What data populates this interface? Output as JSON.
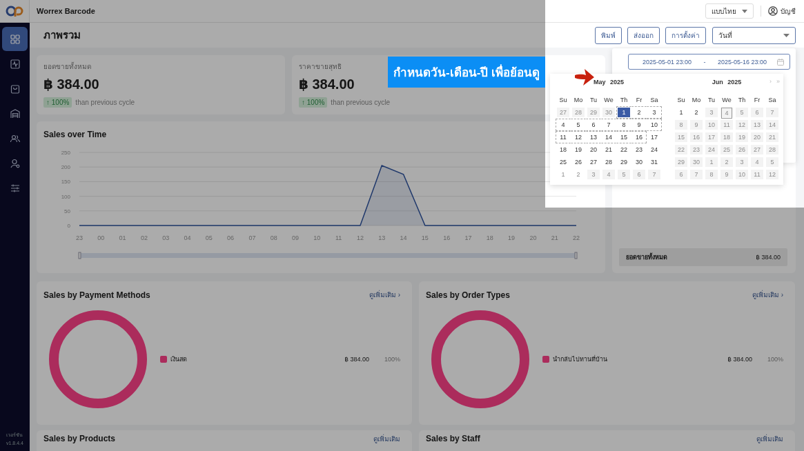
{
  "app": {
    "title": "Worrex Barcode",
    "version_label": "เวอร์ชัน",
    "version": "v1.8.4.4"
  },
  "topbar": {
    "language": "แบบไทย",
    "account": "บัญชี"
  },
  "sidebar": {
    "items": [
      {
        "kind": "grid",
        "selected": true
      },
      {
        "kind": "pulse",
        "selected": false
      },
      {
        "kind": "bag",
        "selected": false
      },
      {
        "kind": "garage",
        "selected": false
      },
      {
        "kind": "users",
        "selected": false
      },
      {
        "kind": "user",
        "selected": false
      },
      {
        "kind": "sliders",
        "selected": false
      }
    ]
  },
  "page": {
    "title": "ภาพรวม",
    "buttons": [
      "พิมพ์",
      "ส่งออก",
      "การตั้งค่า"
    ],
    "period_select": "วันที่"
  },
  "date_range": {
    "start": "2025-05-01 23:00",
    "separator": "-",
    "end": "2025-05-16 23:00"
  },
  "stats": [
    {
      "label": "ยอดขายทั้งหมด",
      "value": "฿ 384.00",
      "change": "↑ 100%",
      "note": "than previous cycle"
    },
    {
      "label": "ราคาขายสุทธิ",
      "value": "฿ 384.00",
      "change": "↑ 100%",
      "note": "than previous cycle"
    }
  ],
  "sales_over_time": {
    "title": "Sales over Time",
    "chart_data": {
      "type": "line",
      "grid": true,
      "categories": [
        "23",
        "00",
        "01",
        "02",
        "03",
        "04",
        "05",
        "06",
        "07",
        "08",
        "09",
        "10",
        "11",
        "12",
        "13",
        "14",
        "15",
        "16",
        "17",
        "18",
        "19",
        "20",
        "21",
        "22"
      ],
      "series": [
        {
          "color": "#2f54a0",
          "values": [
            0,
            0,
            0,
            0,
            0,
            0,
            0,
            0,
            0,
            0,
            0,
            0,
            0,
            0,
            205,
            175,
            0,
            0,
            0,
            0,
            0,
            0,
            0,
            0
          ]
        }
      ],
      "ylim": [
        0,
        250
      ],
      "yticks": [
        0,
        50,
        100,
        150,
        200,
        250
      ]
    }
  },
  "summary": {
    "label": "ยอดขายทั้งหมด",
    "value": "฿ 384.00"
  },
  "breakdowns": [
    {
      "title": "Sales by Payment Methods",
      "link": "ดูเพิ่มเติม ›",
      "items": [
        {
          "label": "เงินสด",
          "amount": "฿ 384.00",
          "percent": "100%",
          "color": "#b02c5c"
        }
      ]
    },
    {
      "title": "Sales by Order Types",
      "link": "ดูเพิ่มเติม ›",
      "items": [
        {
          "label": "นำกลับไปทานที่บ้าน",
          "amount": "฿ 384.00",
          "percent": "100%",
          "color": "#b02c5c"
        }
      ]
    }
  ],
  "more_sections": [
    {
      "title": "Sales by Products",
      "link": "ดูเพิ่มเติม"
    },
    {
      "title": "Sales by Staff",
      "link": "ดูเพิ่มเติม"
    }
  ],
  "calendar": {
    "months": [
      {
        "title": "May 2025",
        "weekdays": [
          "Su",
          "Mo",
          "Tu",
          "We",
          "Th",
          "Fr",
          "Sa"
        ],
        "weeks": [
          [
            {
              "label": "27",
              "muted": true,
              "disabled": true,
              "selected": false,
              "in_range": false,
              "today": false
            },
            {
              "label": "28",
              "muted": true,
              "disabled": true,
              "selected": false,
              "in_range": false,
              "today": false
            },
            {
              "label": "29",
              "muted": true,
              "disabled": true,
              "selected": false,
              "in_range": false,
              "today": false
            },
            {
              "label": "30",
              "muted": true,
              "disabled": true,
              "selected": false,
              "in_range": false,
              "today": false
            },
            {
              "label": "1",
              "muted": false,
              "disabled": false,
              "selected": true,
              "in_range": true,
              "today": false
            },
            {
              "label": "2",
              "muted": false,
              "disabled": false,
              "selected": false,
              "in_range": true,
              "today": false
            },
            {
              "label": "3",
              "muted": false,
              "disabled": false,
              "selected": false,
              "in_range": true,
              "today": false
            }
          ],
          [
            {
              "label": "4",
              "muted": false,
              "disabled": false,
              "selected": false,
              "in_range": true,
              "today": false
            },
            {
              "label": "5",
              "muted": false,
              "disabled": false,
              "selected": false,
              "in_range": true,
              "today": false
            },
            {
              "label": "6",
              "muted": false,
              "disabled": false,
              "selected": false,
              "in_range": true,
              "today": false
            },
            {
              "label": "7",
              "muted": false,
              "disabled": false,
              "selected": false,
              "in_range": true,
              "today": false
            },
            {
              "label": "8",
              "muted": false,
              "disabled": false,
              "selected": false,
              "in_range": true,
              "today": false
            },
            {
              "label": "9",
              "muted": false,
              "disabled": false,
              "selected": false,
              "in_range": true,
              "today": false
            },
            {
              "label": "10",
              "muted": false,
              "disabled": false,
              "selected": false,
              "in_range": true,
              "today": false
            }
          ],
          [
            {
              "label": "11",
              "muted": false,
              "disabled": false,
              "selected": false,
              "in_range": true,
              "today": false
            },
            {
              "label": "12",
              "muted": false,
              "disabled": false,
              "selected": false,
              "in_range": true,
              "today": false
            },
            {
              "label": "13",
              "muted": false,
              "disabled": false,
              "selected": false,
              "in_range": true,
              "today": false
            },
            {
              "label": "14",
              "muted": false,
              "disabled": false,
              "selected": false,
              "in_range": true,
              "today": false
            },
            {
              "label": "15",
              "muted": false,
              "disabled": false,
              "selected": false,
              "in_range": true,
              "today": false
            },
            {
              "label": "16",
              "muted": false,
              "disabled": false,
              "selected": false,
              "in_range": true,
              "today": false
            },
            {
              "label": "17",
              "muted": false,
              "disabled": false,
              "selected": false,
              "in_range": false,
              "today": false
            }
          ],
          [
            {
              "label": "18",
              "muted": false,
              "disabled": false,
              "selected": false,
              "in_range": false,
              "today": false
            },
            {
              "label": "19",
              "muted": false,
              "disabled": false,
              "selected": false,
              "in_range": false,
              "today": false
            },
            {
              "label": "20",
              "muted": false,
              "disabled": false,
              "selected": false,
              "in_range": false,
              "today": false
            },
            {
              "label": "21",
              "muted": false,
              "disabled": false,
              "selected": false,
              "in_range": false,
              "today": false
            },
            {
              "label": "22",
              "muted": false,
              "disabled": false,
              "selected": false,
              "in_range": false,
              "today": false
            },
            {
              "label": "23",
              "muted": false,
              "disabled": false,
              "selected": false,
              "in_range": false,
              "today": false
            },
            {
              "label": "24",
              "muted": false,
              "disabled": false,
              "selected": false,
              "in_range": false,
              "today": false
            }
          ],
          [
            {
              "label": "25",
              "muted": false,
              "disabled": false,
              "selected": false,
              "in_range": false,
              "today": false
            },
            {
              "label": "26",
              "muted": false,
              "disabled": false,
              "selected": false,
              "in_range": false,
              "today": false
            },
            {
              "label": "27",
              "muted": false,
              "disabled": false,
              "selected": false,
              "in_range": false,
              "today": false
            },
            {
              "label": "28",
              "muted": false,
              "disabled": false,
              "selected": false,
              "in_range": false,
              "today": false
            },
            {
              "label": "29",
              "muted": false,
              "disabled": false,
              "selected": false,
              "in_range": false,
              "today": false
            },
            {
              "label": "30",
              "muted": false,
              "disabled": false,
              "selected": false,
              "in_range": false,
              "today": false
            },
            {
              "label": "31",
              "muted": false,
              "disabled": false,
              "selected": false,
              "in_range": false,
              "today": false
            }
          ],
          [
            {
              "label": "1",
              "muted": true,
              "disabled": false,
              "selected": false,
              "in_range": false,
              "today": false
            },
            {
              "label": "2",
              "muted": true,
              "disabled": false,
              "selected": false,
              "in_range": false,
              "today": false
            },
            {
              "label": "3",
              "muted": true,
              "disabled": true,
              "selected": false,
              "in_range": false,
              "today": false
            },
            {
              "label": "4",
              "muted": true,
              "disabled": true,
              "selected": false,
              "in_range": false,
              "today": false
            },
            {
              "label": "5",
              "muted": true,
              "disabled": true,
              "selected": false,
              "in_range": false,
              "today": false
            },
            {
              "label": "6",
              "muted": true,
              "disabled": true,
              "selected": false,
              "in_range": false,
              "today": false
            },
            {
              "label": "7",
              "muted": true,
              "disabled": true,
              "selected": false,
              "in_range": false,
              "today": false
            }
          ]
        ]
      },
      {
        "title": "Jun 2025",
        "nav": [
          "›",
          "»"
        ],
        "weekdays": [
          "Su",
          "Mo",
          "Tu",
          "We",
          "Th",
          "Fr",
          "Sa"
        ],
        "weeks": [
          [
            {
              "label": "1",
              "muted": false,
              "disabled": false,
              "selected": false,
              "in_range": false,
              "today": false
            },
            {
              "label": "2",
              "muted": false,
              "disabled": false,
              "selected": false,
              "in_range": false,
              "today": false
            },
            {
              "label": "3",
              "muted": true,
              "disabled": true,
              "selected": false,
              "in_range": false,
              "today": false
            },
            {
              "label": "4",
              "muted": true,
              "disabled": true,
              "selected": false,
              "in_range": false,
              "today": true
            },
            {
              "label": "5",
              "muted": true,
              "disabled": true,
              "selected": false,
              "in_range": false,
              "today": false
            },
            {
              "label": "6",
              "muted": true,
              "disabled": true,
              "selected": false,
              "in_range": false,
              "today": false
            },
            {
              "label": "7",
              "muted": true,
              "disabled": true,
              "selected": false,
              "in_range": false,
              "today": false
            }
          ],
          [
            {
              "label": "8",
              "muted": true,
              "disabled": true,
              "selected": false,
              "in_range": false,
              "today": false
            },
            {
              "label": "9",
              "muted": true,
              "disabled": true,
              "selected": false,
              "in_range": false,
              "today": false
            },
            {
              "label": "10",
              "muted": true,
              "disabled": true,
              "selected": false,
              "in_range": false,
              "today": false
            },
            {
              "label": "11",
              "muted": true,
              "disabled": true,
              "selected": false,
              "in_range": false,
              "today": false
            },
            {
              "label": "12",
              "muted": true,
              "disabled": true,
              "selected": false,
              "in_range": false,
              "today": false
            },
            {
              "label": "13",
              "muted": true,
              "disabled": true,
              "selected": false,
              "in_range": false,
              "today": false
            },
            {
              "label": "14",
              "muted": true,
              "disabled": true,
              "selected": false,
              "in_range": false,
              "today": false
            }
          ],
          [
            {
              "label": "15",
              "muted": true,
              "disabled": true,
              "selected": false,
              "in_range": false,
              "today": false
            },
            {
              "label": "16",
              "muted": true,
              "disabled": true,
              "selected": false,
              "in_range": false,
              "today": false
            },
            {
              "label": "17",
              "muted": true,
              "disabled": true,
              "selected": false,
              "in_range": false,
              "today": false
            },
            {
              "label": "18",
              "muted": true,
              "disabled": true,
              "selected": false,
              "in_range": false,
              "today": false
            },
            {
              "label": "19",
              "muted": true,
              "disabled": true,
              "selected": false,
              "in_range": false,
              "today": false
            },
            {
              "label": "20",
              "muted": true,
              "disabled": true,
              "selected": false,
              "in_range": false,
              "today": false
            },
            {
              "label": "21",
              "muted": true,
              "disabled": true,
              "selected": false,
              "in_range": false,
              "today": false
            }
          ],
          [
            {
              "label": "22",
              "muted": true,
              "disabled": true,
              "selected": false,
              "in_range": false,
              "today": false
            },
            {
              "label": "23",
              "muted": true,
              "disabled": true,
              "selected": false,
              "in_range": false,
              "today": false
            },
            {
              "label": "24",
              "muted": true,
              "disabled": true,
              "selected": false,
              "in_range": false,
              "today": false
            },
            {
              "label": "25",
              "muted": true,
              "disabled": true,
              "selected": false,
              "in_range": false,
              "today": false
            },
            {
              "label": "26",
              "muted": true,
              "disabled": true,
              "selected": false,
              "in_range": false,
              "today": false
            },
            {
              "label": "27",
              "muted": true,
              "disabled": true,
              "selected": false,
              "in_range": false,
              "today": false
            },
            {
              "label": "28",
              "muted": true,
              "disabled": true,
              "selected": false,
              "in_range": false,
              "today": false
            }
          ],
          [
            {
              "label": "29",
              "muted": true,
              "disabled": true,
              "selected": false,
              "in_range": false,
              "today": false
            },
            {
              "label": "30",
              "muted": true,
              "disabled": true,
              "selected": false,
              "in_range": false,
              "today": false
            },
            {
              "label": "1",
              "muted": true,
              "disabled": true,
              "selected": false,
              "in_range": false,
              "today": false
            },
            {
              "label": "2",
              "muted": true,
              "disabled": true,
              "selected": false,
              "in_range": false,
              "today": false
            },
            {
              "label": "3",
              "muted": true,
              "disabled": true,
              "selected": false,
              "in_range": false,
              "today": false
            },
            {
              "label": "4",
              "muted": true,
              "disabled": true,
              "selected": false,
              "in_range": false,
              "today": false
            },
            {
              "label": "5",
              "muted": true,
              "disabled": true,
              "selected": false,
              "in_range": false,
              "today": false
            }
          ],
          [
            {
              "label": "6",
              "muted": true,
              "disabled": true,
              "selected": false,
              "in_range": false,
              "today": false
            },
            {
              "label": "7",
              "muted": true,
              "disabled": true,
              "selected": false,
              "in_range": false,
              "today": false
            },
            {
              "label": "8",
              "muted": true,
              "disabled": true,
              "selected": false,
              "in_range": false,
              "today": false
            },
            {
              "label": "9",
              "muted": true,
              "disabled": true,
              "selected": false,
              "in_range": false,
              "today": false
            },
            {
              "label": "10",
              "muted": true,
              "disabled": true,
              "selected": false,
              "in_range": false,
              "today": false
            },
            {
              "label": "11",
              "muted": true,
              "disabled": true,
              "selected": false,
              "in_range": false,
              "today": false
            },
            {
              "label": "12",
              "muted": true,
              "disabled": true,
              "selected": false,
              "in_range": false,
              "today": false
            }
          ]
        ]
      }
    ]
  },
  "caption": {
    "text": "กำหนดวัน-เดือน-ปี เพื่อย้อนดู"
  }
}
